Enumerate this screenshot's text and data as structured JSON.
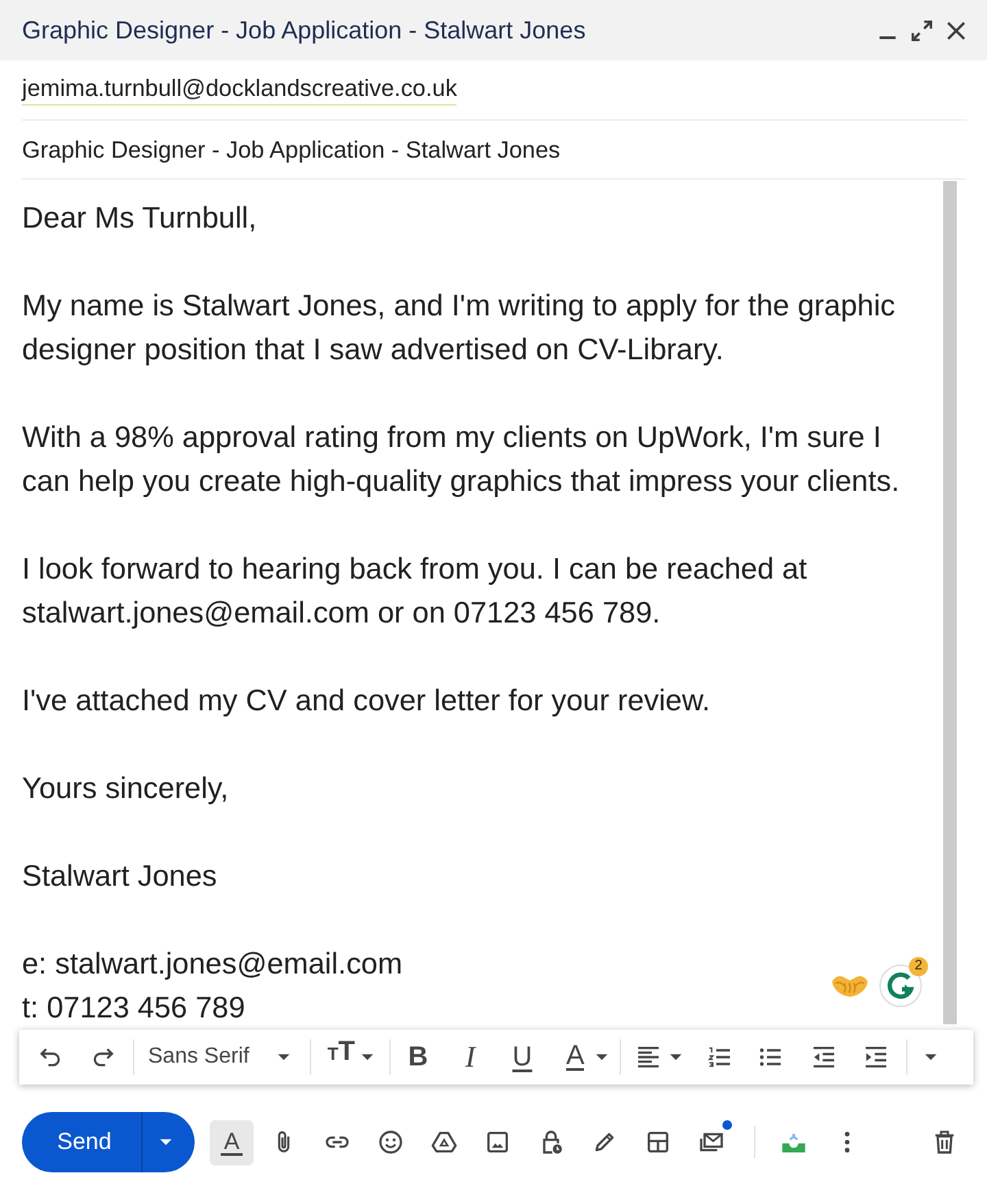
{
  "window": {
    "title": "Graphic Designer - Job Application - Stalwart Jones"
  },
  "recipient": "jemima.turnbull@docklandscreative.co.uk",
  "subject": "Graphic Designer - Job Application - Stalwart Jones",
  "body": {
    "paragraphs": [
      [
        "Dear Ms Turnbull,"
      ],
      [
        "My name is Stalwart Jones, and I'm writing to apply for the graphic designer position that I saw advertised on CV-Library."
      ],
      [
        "With a 98% approval rating from my clients on UpWork, I'm sure I can help you create high-quality graphics that impress your clients."
      ],
      [
        "I look forward to hearing back from you. I can be reached at stalwart.jones@email.com or on 07123 456 789."
      ],
      [
        "I've attached my CV and cover letter for your review."
      ],
      [
        "Yours sincerely,"
      ],
      [
        "Stalwart Jones"
      ],
      [
        "e: stalwart.jones@email.com",
        "t: 07123 456 789"
      ]
    ]
  },
  "grammar_badge": "2",
  "format_toolbar": {
    "font": "Sans Serif",
    "size_label": "TT",
    "styles": [
      {
        "kind": "bold",
        "label": "B"
      },
      {
        "kind": "italic",
        "label": "I"
      },
      {
        "kind": "underline",
        "label": "U"
      },
      {
        "kind": "color",
        "label": "A"
      }
    ]
  },
  "bottom_bar": {
    "send": "Send",
    "format_button": {
      "label": "A",
      "selected": true
    },
    "mail_notification": true
  }
}
